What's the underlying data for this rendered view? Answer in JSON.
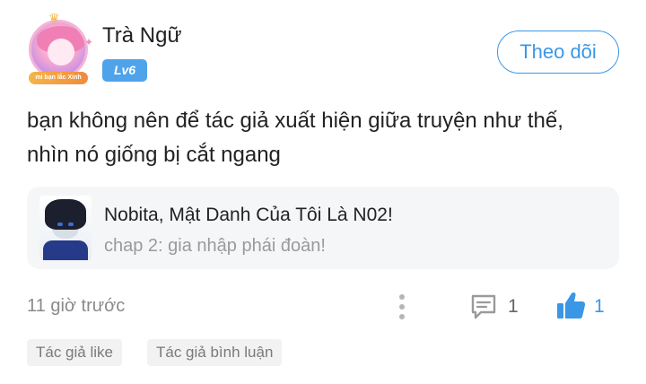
{
  "user": {
    "name": "Trà Ngữ",
    "level": "Lv6",
    "avatar_badge_text": "mi bạn lắc Xinh"
  },
  "follow_button": {
    "label": "Theo dõi"
  },
  "comment": {
    "text_line1": "bạn không nên để tác giả xuất hiện giữa truyện như thế,",
    "text_line2": "nhìn nó giống bị cắt ngang"
  },
  "reference": {
    "story_title": "Nobita, Mật Danh Của Tôi Là N02!",
    "chapter": "chap 2: gia nhập phái đoàn!"
  },
  "meta": {
    "timestamp": "11 giờ trước",
    "comment_count": "1",
    "like_count": "1"
  },
  "tags": [
    "Tác giả like",
    "Tác giả bình luận"
  ],
  "colors": {
    "accent": "#3a97e6",
    "level_badge": "#4fa3ea",
    "card_bg": "#f5f6f8",
    "muted_text": "#8a8a8a"
  },
  "icons": {
    "more": "vertical-dots-icon",
    "comment": "comment-bubble-icon",
    "like": "thumbs-up-icon"
  }
}
